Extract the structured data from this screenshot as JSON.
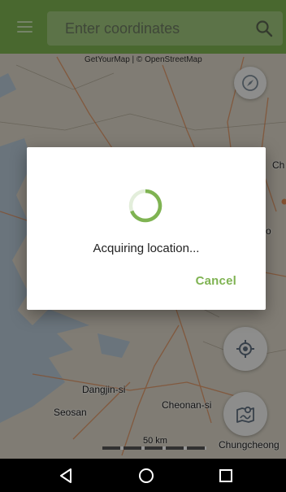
{
  "search": {
    "placeholder": "Enter coordinates"
  },
  "map": {
    "attribution": "GetYourMap | © OpenStreetMap",
    "labels": {
      "dangjin": "Dangjin-si",
      "seosan": "Seosan",
      "cheonan": "Cheonan-si",
      "chungcheong": "Chungcheong",
      "edge_ch": "Ch",
      "edge_o": "o"
    },
    "scale_label": "50 km"
  },
  "dialog": {
    "message": "Acquiring location...",
    "cancel_label": "Cancel"
  },
  "colors": {
    "app_bar": "#7fb352",
    "accent": "#7fb352",
    "search_field": "#9fc67c",
    "water": "#b7c9d6",
    "land": "#dcd6c8",
    "road": "#e08a55"
  },
  "icons": {
    "menu": "menu-icon",
    "search": "search-icon",
    "compass": "compass-icon",
    "locate": "my-location-icon",
    "map_layers": "map-route-icon",
    "back": "back-icon",
    "home": "home-icon",
    "recents": "recents-icon"
  }
}
